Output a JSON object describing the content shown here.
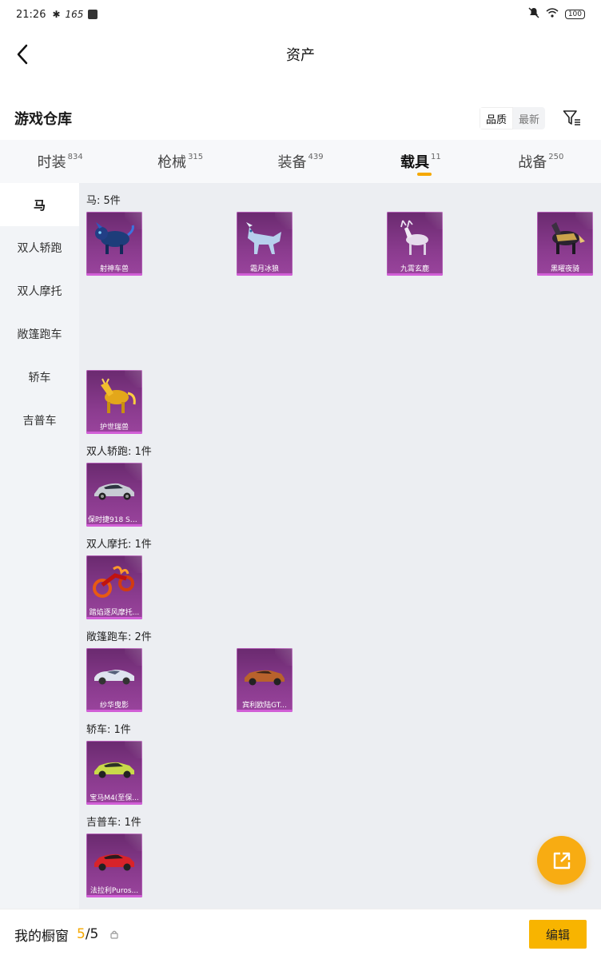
{
  "status_bar": {
    "time": "21:26",
    "speed": "165",
    "battery": "100"
  },
  "header": {
    "title": "资产"
  },
  "section": {
    "title": "游戏仓库",
    "sort_options": [
      "品质",
      "最新"
    ],
    "sort_active": 0
  },
  "tabs": [
    {
      "label": "时装",
      "count": "834"
    },
    {
      "label": "枪械",
      "count": "315"
    },
    {
      "label": "装备",
      "count": "439"
    },
    {
      "label": "载具",
      "count": "11"
    },
    {
      "label": "战备",
      "count": "250"
    }
  ],
  "active_tab": 3,
  "sidebar": {
    "items": [
      "马",
      "双人轿跑",
      "双人摩托",
      "敞篷跑车",
      "轿车",
      "吉普车"
    ],
    "active": 0
  },
  "groups": [
    {
      "label": "马: 5件",
      "items": [
        "射神车兽",
        "霜月冰狼",
        "九霄玄鹿",
        "黑曜夜骑",
        "护世瑞兽"
      ]
    },
    {
      "label": "双人轿跑: 1件",
      "items": [
        "保时捷918 Sp..."
      ]
    },
    {
      "label": "双人摩托: 1件",
      "items": [
        "踏焰逐风摩托..."
      ]
    },
    {
      "label": "敞篷跑车: 2件",
      "items": [
        "纱华曳影",
        "宾利欧陆GT..."
      ]
    },
    {
      "label": "轿车: 1件",
      "items": [
        "宝马M4(至保..."
      ]
    },
    {
      "label": "吉普车: 1件",
      "items": [
        "法拉利Puros..."
      ]
    }
  ],
  "bottom": {
    "title": "我的橱窗",
    "current": "5",
    "total": "/5",
    "edit_label": "编辑"
  },
  "colors": {
    "accent": "#f5a800",
    "card": "#8a3b8e"
  },
  "icons": {
    "back": "chevron-left-icon",
    "filter": "filter-icon",
    "share": "share-external-icon",
    "lock": "lock-icon"
  }
}
